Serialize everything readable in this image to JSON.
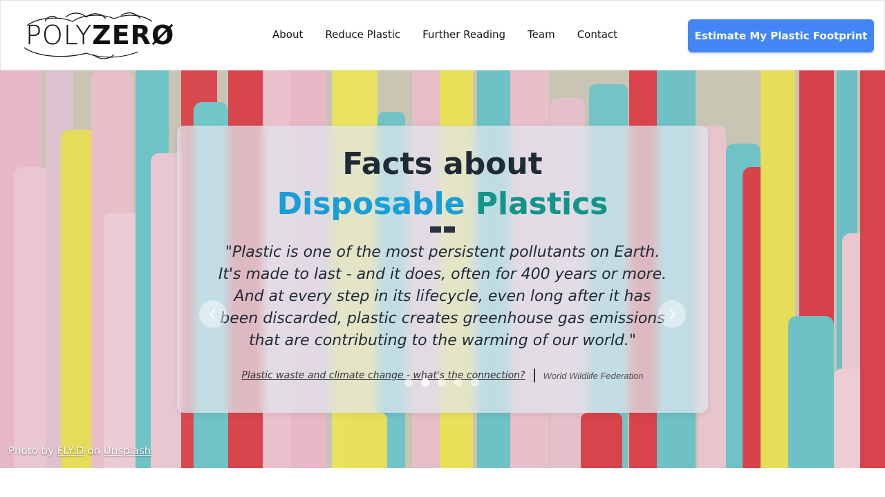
{
  "brand": {
    "logo_text_light": "POLY",
    "logo_text_bold": "ZER",
    "logo_text_zero": "Ø"
  },
  "nav": {
    "items": [
      {
        "label": "About"
      },
      {
        "label": "Reduce Plastic"
      },
      {
        "label": "Further Reading"
      },
      {
        "label": "Team"
      },
      {
        "label": "Contact"
      }
    ]
  },
  "cta": {
    "label": "Estimate My Plastic Footprint",
    "color": "#4285f4"
  },
  "hero": {
    "title_line1": "Facts about",
    "title_line2_part1": "Disposable",
    "title_line2_part2": "Plastics",
    "quote": "\"Plastic is one of the most persistent pollutants on Earth. It's made to last - and it does, often for 400 years or more. And at every step in its lifecycle, even long after it has been discarded, plastic creates greenhouse gas emissions that are contributing to the warming of our world.\"",
    "source_link": "Plastic waste and climate change - what's the connection?",
    "source_org": "World Wildlife Federation",
    "carousel": {
      "total_slides": 5,
      "active_index": 1
    },
    "prev_icon": "chevron-left-icon",
    "next_icon": "chevron-right-icon"
  },
  "credit": {
    "prefix": "Photo by",
    "author": "FLY:D",
    "middle": "on",
    "site": "Unsplash"
  }
}
